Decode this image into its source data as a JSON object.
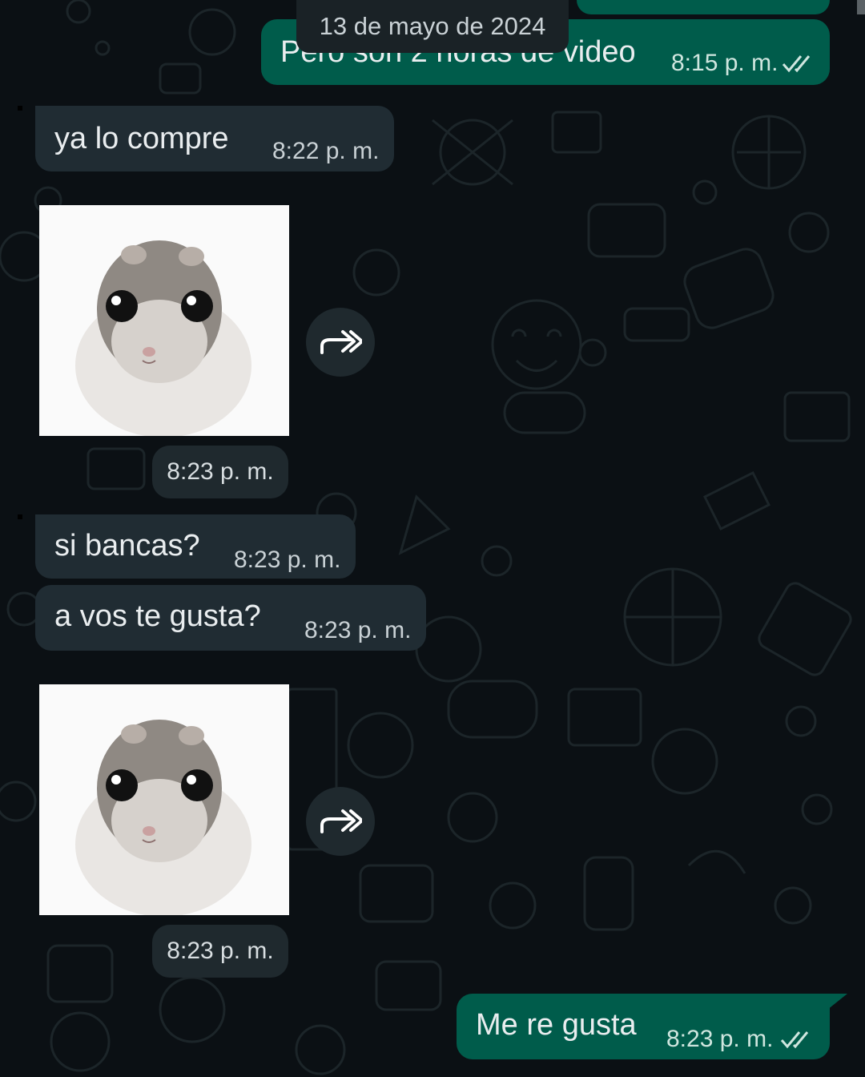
{
  "date_chip": "13 de mayo de 2024",
  "messages": [
    {
      "text": "Pero son 2 horas de video",
      "time": "8:15 p. m.",
      "direction": "out",
      "status": "read"
    },
    {
      "text": "ya lo compre",
      "time": "8:22 p. m.",
      "direction": "in"
    },
    {
      "type": "sticker",
      "sticker": "sad-hamster-sticker",
      "time": "8:23 p. m.",
      "direction": "in"
    },
    {
      "text": "si bancas?",
      "time": "8:23 p. m.",
      "direction": "in"
    },
    {
      "text": "a vos te gusta?",
      "time": "8:23 p. m.",
      "direction": "in"
    },
    {
      "type": "sticker",
      "sticker": "sad-hamster-sticker",
      "time": "8:23 p. m.",
      "direction": "in"
    },
    {
      "text": "Me re gusta",
      "time": "8:23 p. m.",
      "direction": "out",
      "status": "read"
    }
  ],
  "colors": {
    "background": "#0b1014",
    "incoming_bubble": "#202c33",
    "outgoing_bubble": "#005c4b",
    "read_ticks": "#cfe6df"
  },
  "icons": [
    "forward-icon",
    "double-check-icon"
  ]
}
